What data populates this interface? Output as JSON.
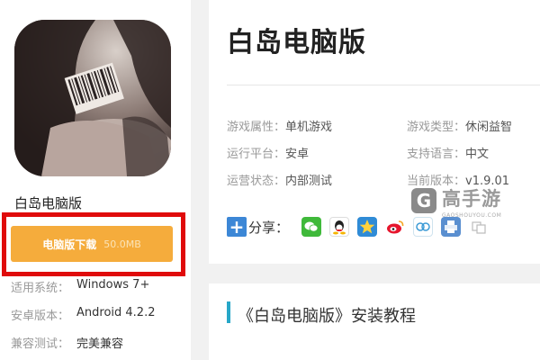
{
  "game": {
    "name": "白岛电脑版",
    "title": "白岛电脑版"
  },
  "download": {
    "label": "电脑版下载",
    "size": "50.0MB"
  },
  "specs": [
    {
      "key": "适用系统：",
      "value": "Windows 7+"
    },
    {
      "key": "安卓版本：",
      "value": "Android 4.2.2"
    },
    {
      "key": "兼容测试：",
      "value": "完美兼容"
    }
  ],
  "attributes": [
    {
      "key": "游戏属性：",
      "value": "单机游戏"
    },
    {
      "key": "游戏类型：",
      "value": "休闲益智"
    },
    {
      "key": "运行平台：",
      "value": "安卓"
    },
    {
      "key": "支持语言：",
      "value": "中文"
    },
    {
      "key": "运营状态：",
      "value": "内部测试"
    },
    {
      "key": "当前版本：",
      "value": "v1.9.01"
    }
  ],
  "share": {
    "label": "分享：",
    "icons": [
      "wechat-icon",
      "qq-icon",
      "qzone-icon",
      "weibo-icon",
      "tencent-weibo-icon",
      "print-icon",
      "more-icon"
    ]
  },
  "watermark": {
    "brand": "高手游",
    "url": "GAOSHOUYOU.COM",
    "glyph": "G"
  },
  "tutorial": {
    "title": "《白岛电脑版》安装教程"
  },
  "colors": {
    "download": "#f5ac3c",
    "highlight": "#e00b0b",
    "accent": "#27a7c8",
    "share_plus": "#3c87d6"
  }
}
